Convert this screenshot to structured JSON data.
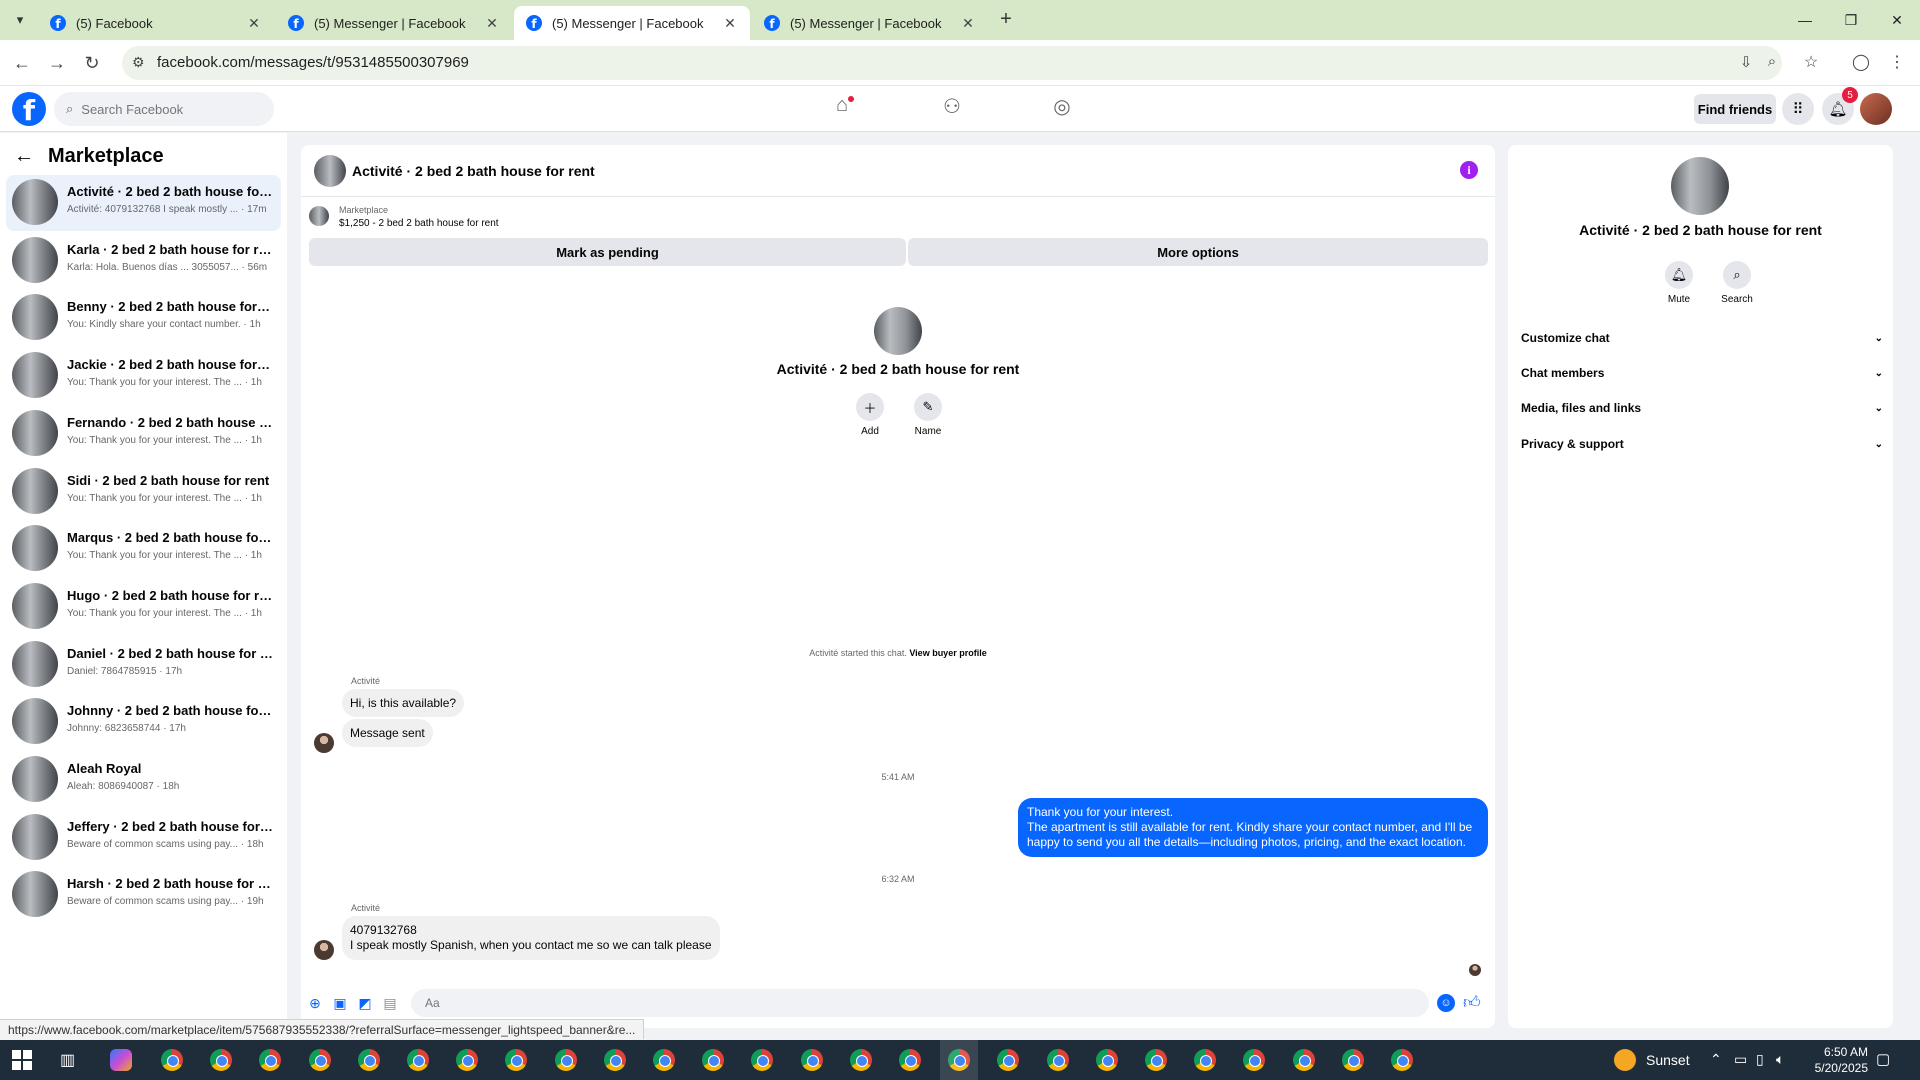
{
  "browser": {
    "tabs": [
      {
        "title": "(5) Facebook",
        "active": false
      },
      {
        "title": "(5) Messenger | Facebook",
        "active": false
      },
      {
        "title": "(5) Messenger | Facebook",
        "active": true
      },
      {
        "title": "(5) Messenger | Facebook",
        "active": false
      }
    ],
    "new_tab_label": "+",
    "url": "facebook.com/messages/t/9531485500307969",
    "status_url": "https://www.facebook.com/marketplace/item/575687935552338/?referralSurface=messenger_lightspeed_banner&re..."
  },
  "fb": {
    "search_placeholder": "Search Facebook",
    "find_friends": "Find friends",
    "notifications_count": "5"
  },
  "sidebar": {
    "title": "Marketplace",
    "conversations": [
      {
        "name": "Activité · 2 bed 2 bath house for re...",
        "snippet": "Activité: 4079132768 I speak mostly ... · 17m",
        "active": true
      },
      {
        "name": "Karla · 2 bed 2 bath house for rent",
        "snippet": "Karla: Hola. Buenos días ... 3055057... · 56m"
      },
      {
        "name": "Benny · 2 bed 2 bath house for rent",
        "snippet": "You: Kindly share your contact number. · 1h"
      },
      {
        "name": "Jackie · 2 bed 2 bath house for rent",
        "snippet": "You: Thank you for your interest. The ... · 1h"
      },
      {
        "name": "Fernando · 2 bed 2 bath house for ...",
        "snippet": "You: Thank you for your interest. The ... · 1h"
      },
      {
        "name": "Sidi · 2 bed 2 bath house for rent",
        "snippet": "You: Thank you for your interest. The ... · 1h"
      },
      {
        "name": "Marqus · 2 bed 2 bath house for re...",
        "snippet": "You: Thank you for your interest. The ... · 1h"
      },
      {
        "name": "Hugo · 2 bed 2 bath house for rent",
        "snippet": "You: Thank you for your interest. The ... · 1h"
      },
      {
        "name": "Daniel · 2 bed 2 bath house for rent",
        "snippet": "Daniel: 7864785915 · 17h"
      },
      {
        "name": "Johnny · 2 bed 2 bath house for rent",
        "snippet": "Johnny: 6823658744 · 17h"
      },
      {
        "name": "Aleah Royal",
        "snippet": "Aleah: 8086940087 · 18h"
      },
      {
        "name": "Jeffery · 2 bed 2 bath house for rent",
        "snippet": "Beware of common scams using pay... · 18h"
      },
      {
        "name": "Harsh · 2 bed 2 bath house for rent",
        "snippet": "Beware of common scams using pay... · 19h"
      }
    ]
  },
  "chat": {
    "title": "Activité · 2 bed 2 bath house for rent",
    "listing_label": "Marketplace",
    "listing_price": "$1,250 - 2 bed 2 bath house for rent",
    "mark_pending": "Mark as pending",
    "more_options": "More options",
    "intro_title": "Activité · 2 bed 2 bath house for rent",
    "intro_add": "Add",
    "intro_name": "Name",
    "started_text": "Activité started this chat.",
    "view_buyer_profile": "View buyer profile",
    "sender_1": "Activité",
    "msg_1": "Hi, is this available?",
    "msg_2": "Message sent",
    "time_1": "5:41 AM",
    "out_line_1": "Thank you for your interest.",
    "out_line_2": "The apartment is still available for rent. Kindly share your contact number, and I'll be happy to send you all the details—including photos, pricing, and the exact location.",
    "time_2": "6:32 AM",
    "sender_2": "Activité",
    "msg_3_line_1": "4079132768",
    "msg_3_line_2": "I speak mostly Spanish, when you contact me so we can talk please",
    "composer_placeholder": "Aa"
  },
  "details": {
    "title": "Activité · 2 bed 2 bath house for rent",
    "mute": "Mute",
    "search": "Search",
    "sections": [
      "Customize chat",
      "Chat members",
      "Media, files and links",
      "Privacy & support"
    ]
  },
  "taskbar": {
    "weather": "Sunset",
    "time": "6:50 AM",
    "date": "5/20/2025"
  },
  "colors": {
    "accent": "#0866ff",
    "tabstrip": "#d7e8c8",
    "info_icon": "#a020f0",
    "taskbar": "#1f2d3a"
  }
}
